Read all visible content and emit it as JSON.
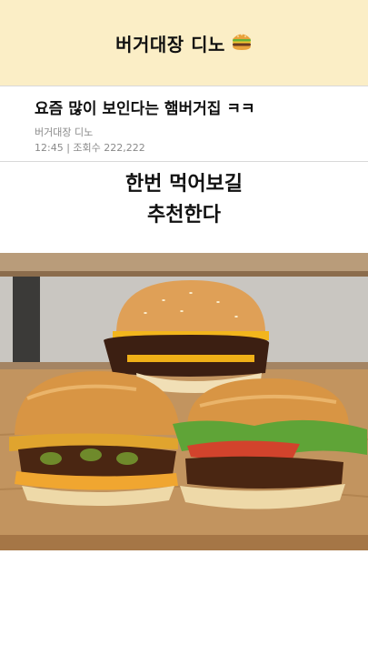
{
  "header": {
    "title": "버거대장 디노",
    "icon": "burger-icon"
  },
  "post": {
    "title": "요즘 많이 보인다는 햄버거집 ㅋㅋ",
    "author": "버거대장 디노",
    "meta": "12:45 | 조회수 222,222"
  },
  "caption": {
    "line1": "한번 먹어보길",
    "line2": "추천한다"
  },
  "photo": {
    "subject": "three-burgers-photo"
  }
}
